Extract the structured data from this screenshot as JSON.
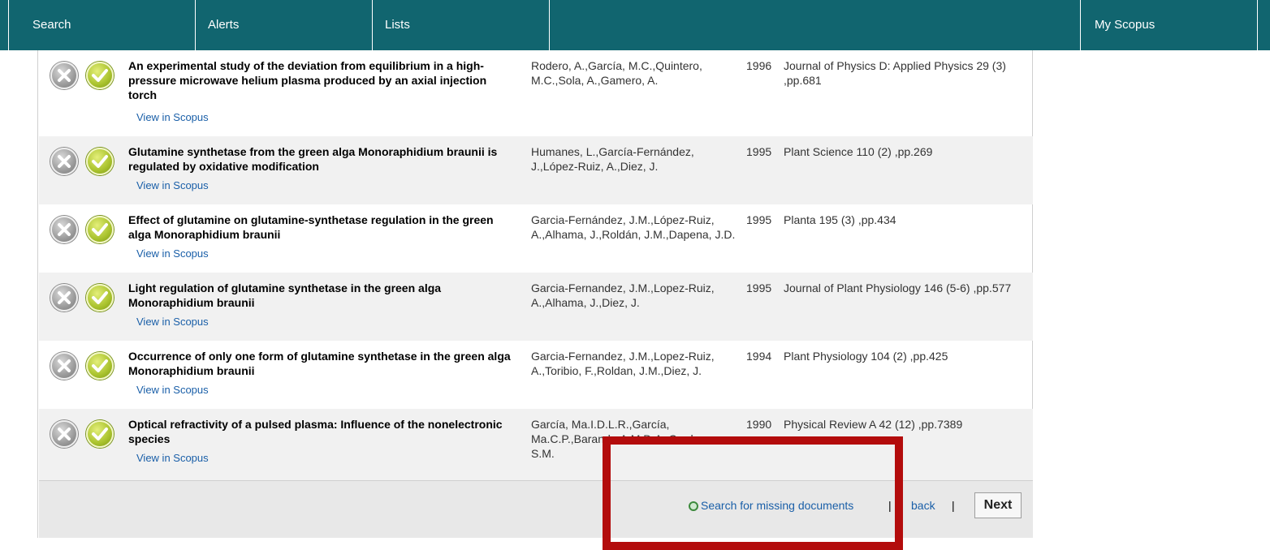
{
  "nav": {
    "search": "Search",
    "alerts": "Alerts",
    "lists": "Lists",
    "my_scopus": "My Scopus"
  },
  "colors": {
    "nav_bg": "#11656f",
    "link": "#1a5fa8",
    "alt_row": "#f1f1f1",
    "highlight_box": "#b30c0c"
  },
  "results": [
    {
      "title": "An experimental study of the deviation from equilibrium in a high-pressure microwave helium plasma produced by an axial injection torch",
      "authors": "Rodero, A.,García, M.C.,Quintero, M.C.,Sola, A.,Gamero, A.",
      "year": "1996",
      "source": "Journal of Physics D: Applied Physics 29 (3) ,pp.681",
      "link": "View in Scopus"
    },
    {
      "title": "Glutamine synthetase from the green alga Monoraphidium braunii is regulated by oxidative modification",
      "authors": "Humanes, L.,García-Fernández, J.,López-Ruiz, A.,Diez, J.",
      "year": "1995",
      "source": "Plant Science 110 (2) ,pp.269",
      "link": "View in Scopus"
    },
    {
      "title": "Effect of glutamine on glutamine-synthetase regulation in the green alga Monoraphidium braunii",
      "authors": "Garcia-Fernández, J.M.,López-Ruiz, A.,Alhama, J.,Roldán, J.M.,Dapena, J.D.",
      "year": "1995",
      "source": "Planta 195 (3) ,pp.434",
      "link": "View in Scopus"
    },
    {
      "title": "Light regulation of glutamine synthetase in the green alga Monoraphidium braunii",
      "authors": "Garcia-Fernandez, J.M.,Lopez-Ruiz, A.,Alhama, J.,Diez, J.",
      "year": "1995",
      "source": "Journal of Plant Physiology 146 (5-6) ,pp.577",
      "link": "View in Scopus"
    },
    {
      "title": "Occurrence of only one form of glutamine synthetase in the green alga Monoraphidium braunii",
      "authors": "Garcia-Fernandez, J.M.,Lopez-Ruiz, A.,Toribio, F.,Roldan, J.M.,Diez, J.",
      "year": "1994",
      "source": "Plant Physiology 104 (2) ,pp.425",
      "link": "View in Scopus"
    },
    {
      "title": "Optical refractivity of a pulsed plasma: Influence of the nonelectronic species",
      "authors": "García, Ma.I.D.L.R.,García, Ma.C.P.,Baranda,A.M.D.A.,Cardona, S.M.",
      "year": "1990",
      "source": "Physical Review A 42 (12) ,pp.7389",
      "link": "View in Scopus"
    }
  ],
  "footer": {
    "missing": "Search for missing documents",
    "separator": "|",
    "back": "back",
    "next": "Next"
  }
}
